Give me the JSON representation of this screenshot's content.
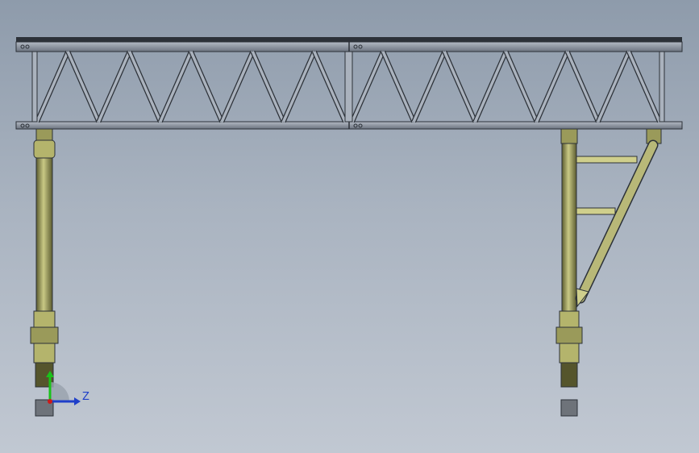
{
  "viewport": {
    "background_top": "#8e9bab",
    "background_bottom": "#c1c8d2"
  },
  "colors": {
    "steel": "#7f8896",
    "steel_dark": "#2c3138",
    "steel_light": "#aab2bd",
    "column": "#9a9a5a",
    "column_light": "#cfcf8c",
    "column_dark": "#55552c",
    "foot": "#6e737a"
  },
  "triad": {
    "axis_z_label": "Z",
    "axis_y_color": "#1ac21a",
    "axis_z_color": "#1f3fc9",
    "axis_x_color": "#cc1a1a",
    "icon": "view-orientation-triad-icon"
  }
}
